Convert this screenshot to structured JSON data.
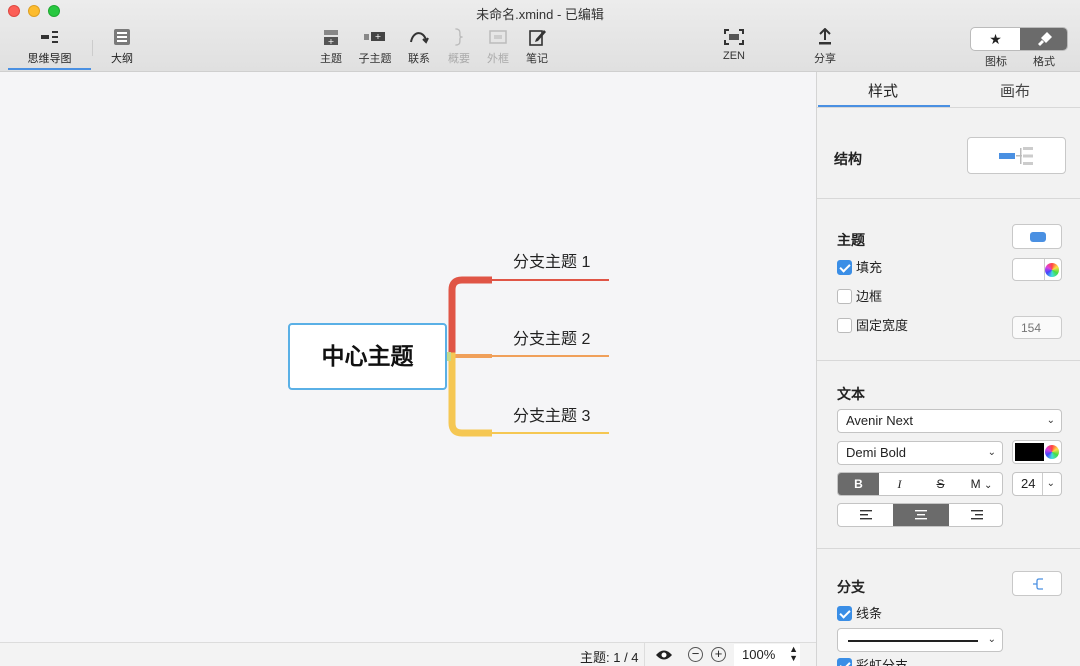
{
  "window": {
    "title": "未命名.xmind - 已编辑"
  },
  "toolbar": {
    "view_tabs": [
      {
        "label": "思维导图"
      },
      {
        "label": "大纲"
      }
    ],
    "buttons": [
      {
        "label": "主题",
        "icon": "topic-icon"
      },
      {
        "label": "子主题",
        "icon": "subtopic-icon"
      },
      {
        "label": "联系",
        "icon": "relationship-icon"
      },
      {
        "label": "概要",
        "icon": "summary-icon"
      },
      {
        "label": "外框",
        "icon": "boundary-icon"
      },
      {
        "label": "笔记",
        "icon": "notes-icon"
      },
      {
        "label": "ZEN",
        "icon": "zen-icon"
      },
      {
        "label": "分享",
        "icon": "share-icon"
      }
    ],
    "right_labels": {
      "icons": "图标",
      "format": "格式"
    }
  },
  "map": {
    "central_topic": "中心主题",
    "branches": [
      {
        "label": "分支主题 1",
        "color": "#e05546"
      },
      {
        "label": "分支主题 2",
        "color": "#f0a05a"
      },
      {
        "label": "分支主题 3",
        "color": "#f5c753"
      }
    ],
    "central_border_color": "#5ab0e6"
  },
  "status": {
    "topic_count": "主题: 1 / 4",
    "zoom": "100%"
  },
  "panel": {
    "tabs": [
      {
        "label": "样式"
      },
      {
        "label": "画布"
      }
    ],
    "structure": {
      "title": "结构"
    },
    "topic": {
      "title": "主题",
      "fill_label": "填充",
      "fill_checked": true,
      "border_label": "边框",
      "border_checked": false,
      "fixed_width_label": "固定宽度",
      "fixed_width_checked": false,
      "fixed_width_placeholder": "154",
      "shape_color": "#4a90e2"
    },
    "text": {
      "title": "文本",
      "font_family": "Avenir Next",
      "font_weight": "Demi Bold",
      "font_size": "24",
      "style_buttons": [
        "B",
        "I",
        "S",
        "M"
      ],
      "text_color": "#000000"
    },
    "branch": {
      "title": "分支",
      "line_label": "线条",
      "line_checked": true,
      "rainbow_label": "彩虹分支"
    }
  }
}
